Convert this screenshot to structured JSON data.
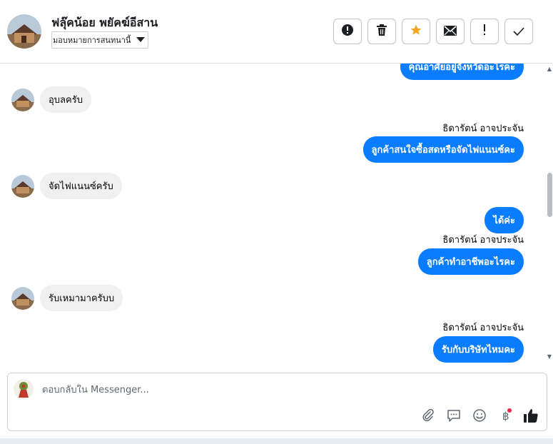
{
  "header": {
    "contact_name": "ฟลุ๊คน้อย พยัคฆ์อีสาน",
    "assign_label": "มอบหมายการสนทนานี้",
    "toolbar": [
      {
        "name": "spam-button",
        "icon": "alert-circle-icon"
      },
      {
        "name": "delete-button",
        "icon": "trash-icon"
      },
      {
        "name": "star-button",
        "icon": "star-icon"
      },
      {
        "name": "mark-unread-button",
        "icon": "envelope-icon"
      },
      {
        "name": "follow-up-button",
        "icon": "exclamation-icon"
      },
      {
        "name": "mark-done-button",
        "icon": "check-icon"
      }
    ]
  },
  "messages": {
    "partial_top": "คุณอาศัยอยู่จังหวัดอะไรคะ",
    "m1_in": "อุบลครับ",
    "sender_1": "ธิดารัตน์ อาจประจัน",
    "m2_out": "ลูกค้าสนใจซื้อสดหรือจัดไฟแนนซ์คะ",
    "m3_in": "จัดไฟแนนซ์ครับ",
    "m4_out": "ได้ค่ะ",
    "sender_2": "ธิดารัตน์ อาจประจัน",
    "m5_out": "ลูกค้าทำอาชีพอะไรคะ",
    "m6_in": "รับเหมามาครับบ",
    "sender_3": "ธิดารัตน์ อาจประจัน",
    "m7_out": "รับกับบริษัทไหมคะ"
  },
  "composer": {
    "placeholder": "ตอบกลับใน Messenger...",
    "icons": [
      "paperclip-icon",
      "saved-reply-icon",
      "emoji-icon",
      "baht-payment-icon",
      "thumbs-up-icon"
    ]
  },
  "colors": {
    "outgoing_bubble": "#0a7cff",
    "incoming_bubble": "#f0f0f0",
    "star": "#f5a623",
    "notification_dot": "#f02849"
  }
}
